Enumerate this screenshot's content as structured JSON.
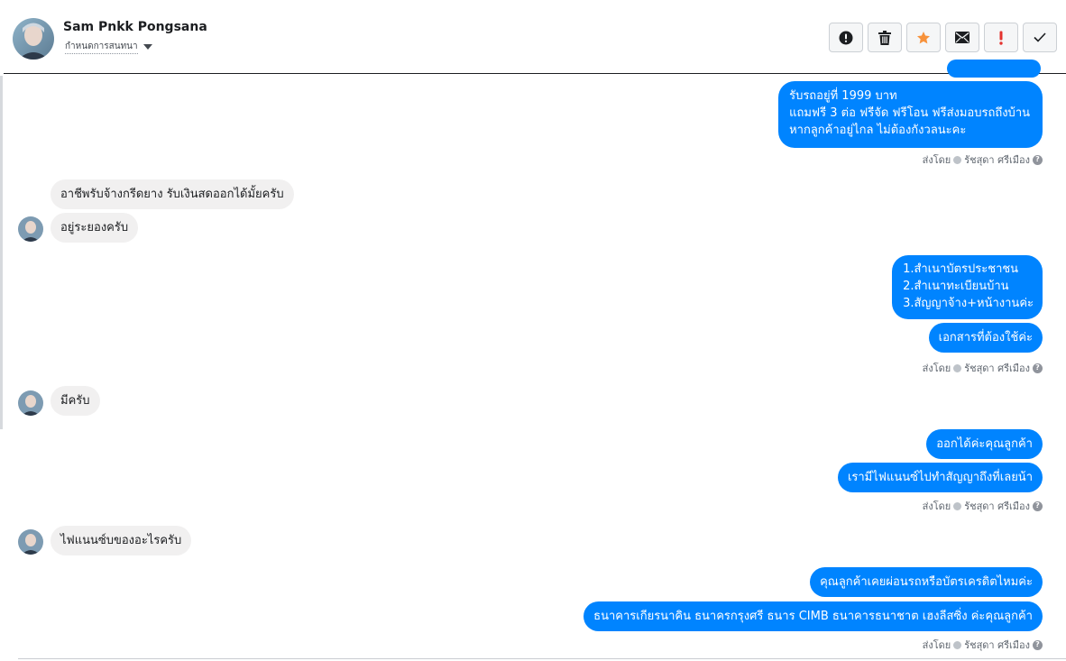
{
  "header": {
    "name": "Sam Pnkk Pongsana",
    "assign_label": "กำหนดการสนทนา",
    "actions": [
      "info",
      "delete",
      "star",
      "mark-unread",
      "spam",
      "done"
    ]
  },
  "messages": {
    "m1_lines": [
      "รับรถอยู่ที่ 1999 บาท",
      "แถมฟรี 3 ต่อ ฟรีจัด ฟรีโอน  ฟรีส่งมอบรถถึงบ้าน",
      "หากลูกค้าอยู่ไกล ไม่ต้องกังวลนะคะ"
    ],
    "status1": "ส่งโดย",
    "sender1": "รัชสุดา ศรีเมือง",
    "in1": "อาชีพรับจ้างกรีดยาง รับเงินสดออกได้มั้ยครับ",
    "in2": "อยู่ระยองครับ",
    "m2_lines": [
      "1.สำเนาบัตรประชาชน",
      "2.สำเนาทะเบียนบ้าน",
      "3.สัญญาจ้าง+หน้างานค่ะ"
    ],
    "m3": "เอกสารที่ต้องใช้ค่ะ",
    "status2": "ส่งโดย",
    "sender2": "รัชสุดา ศรีเมือง",
    "in3": "มีครับ",
    "m4": "ออกได้ค่ะคุณลูกค้า",
    "m5": "เรามีไฟแนนซ์ไปทำสัญญาถึงที่เลยน้า",
    "status3": "ส่งโดย",
    "sender3": "รัชสุดา ศรีเมือง",
    "in4": "ไฟแนนซ์บของอะไรครับ",
    "m6": "คุณลูกค้าเคยผ่อนรถหรือบัตรเครดิตไหมค่ะ",
    "m7": "ธนาคารเกียรนาคิน ธนาครกรุงศรี  ธนาร CIMB  ธนาคารธนาชาต เฮงลีสซิ่ง ค่ะคุณลูกค้า",
    "status4": "ส่งโดย",
    "sender4": "รัชสุดา ศรีเมือง"
  },
  "colors": {
    "outgoing": "#0084ff",
    "incoming": "#f1f0f0",
    "star": "#f7923b"
  }
}
